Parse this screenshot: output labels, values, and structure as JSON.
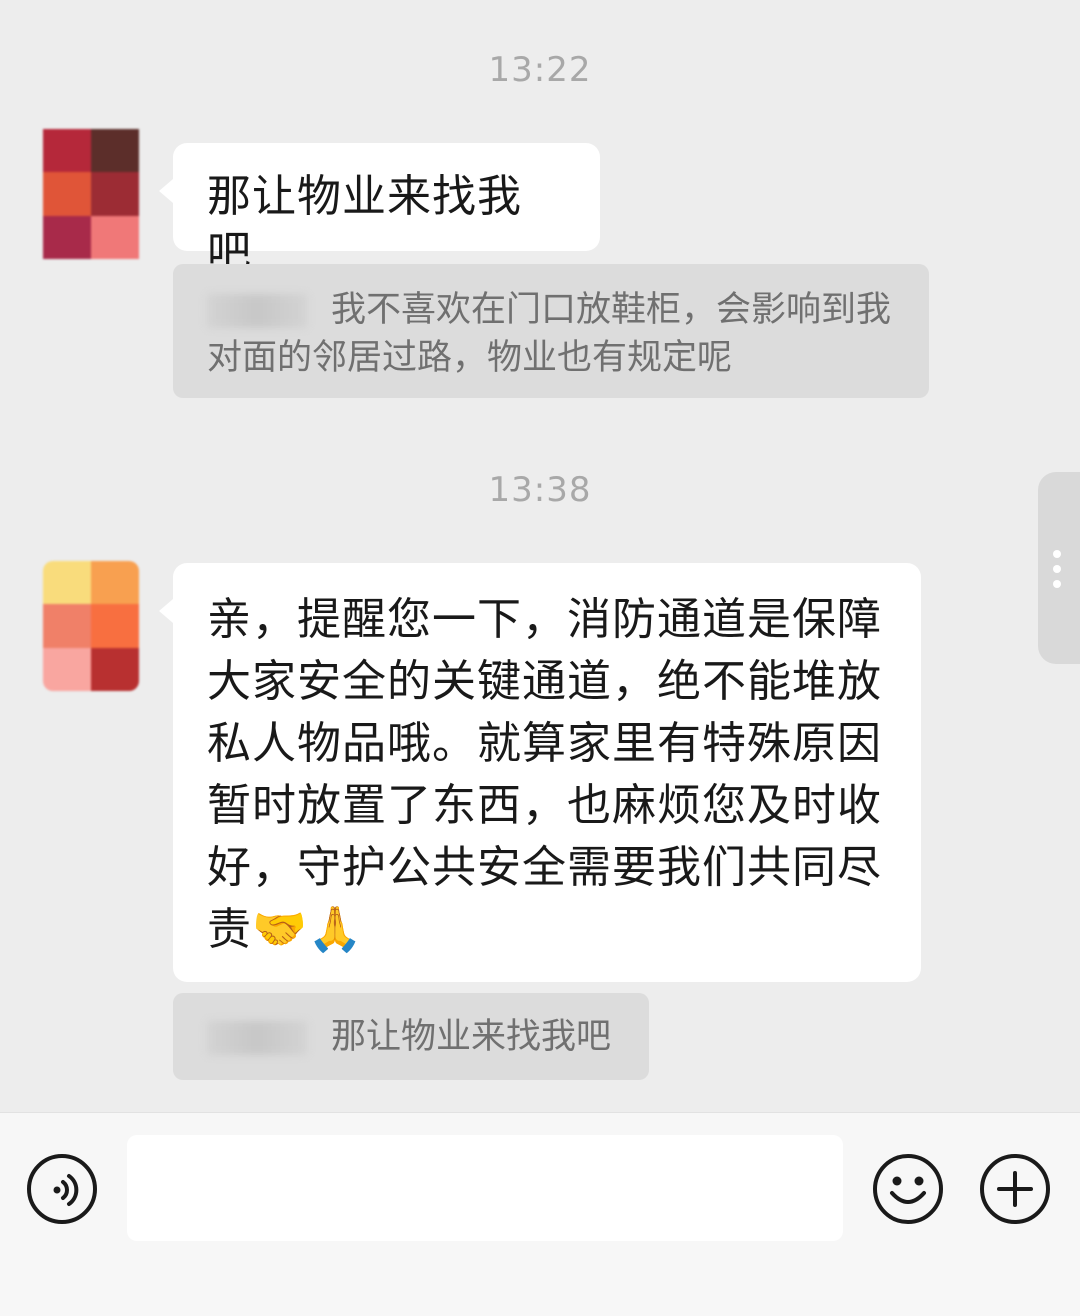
{
  "chat": {
    "timestamps": [
      "13:22",
      "13:38"
    ],
    "message_1": {
      "text": "那让物业来找我吧"
    },
    "quote_1": {
      "text": "我不喜欢在门口放鞋柜，会影响到我对面的邻居过路，物业也有规定呢"
    },
    "message_2": {
      "text": "亲，提醒您一下，消防通道是保障大家安全的关键通道，绝不能堆放私人物品哦。就算家里有特殊原因暂时放置了东西，也麻烦您及时收好，守护公共安全需要我们共同尽责🤝🙏"
    },
    "quote_2": {
      "text": "那让物业来找我吧"
    }
  },
  "avatars": {
    "avatar_1_colors": [
      "#b5283a",
      "#5c2e2a",
      "#e05538",
      "#9c2c34",
      "#a82a4a",
      "#f07878"
    ],
    "avatar_2_colors": [
      "#f9dc7c",
      "#f8a050",
      "#f08068",
      "#f86f40",
      "#f9a6a0",
      "#b83030"
    ]
  },
  "input_bar": {
    "icons": [
      "voice-icon",
      "emoji-icon",
      "plus-icon"
    ],
    "input_value": ""
  },
  "colors": {
    "background": "#ededed",
    "bubble": "#ffffff",
    "quote_bg": "#dcdcdc",
    "timestamp": "#a8a8a8"
  }
}
